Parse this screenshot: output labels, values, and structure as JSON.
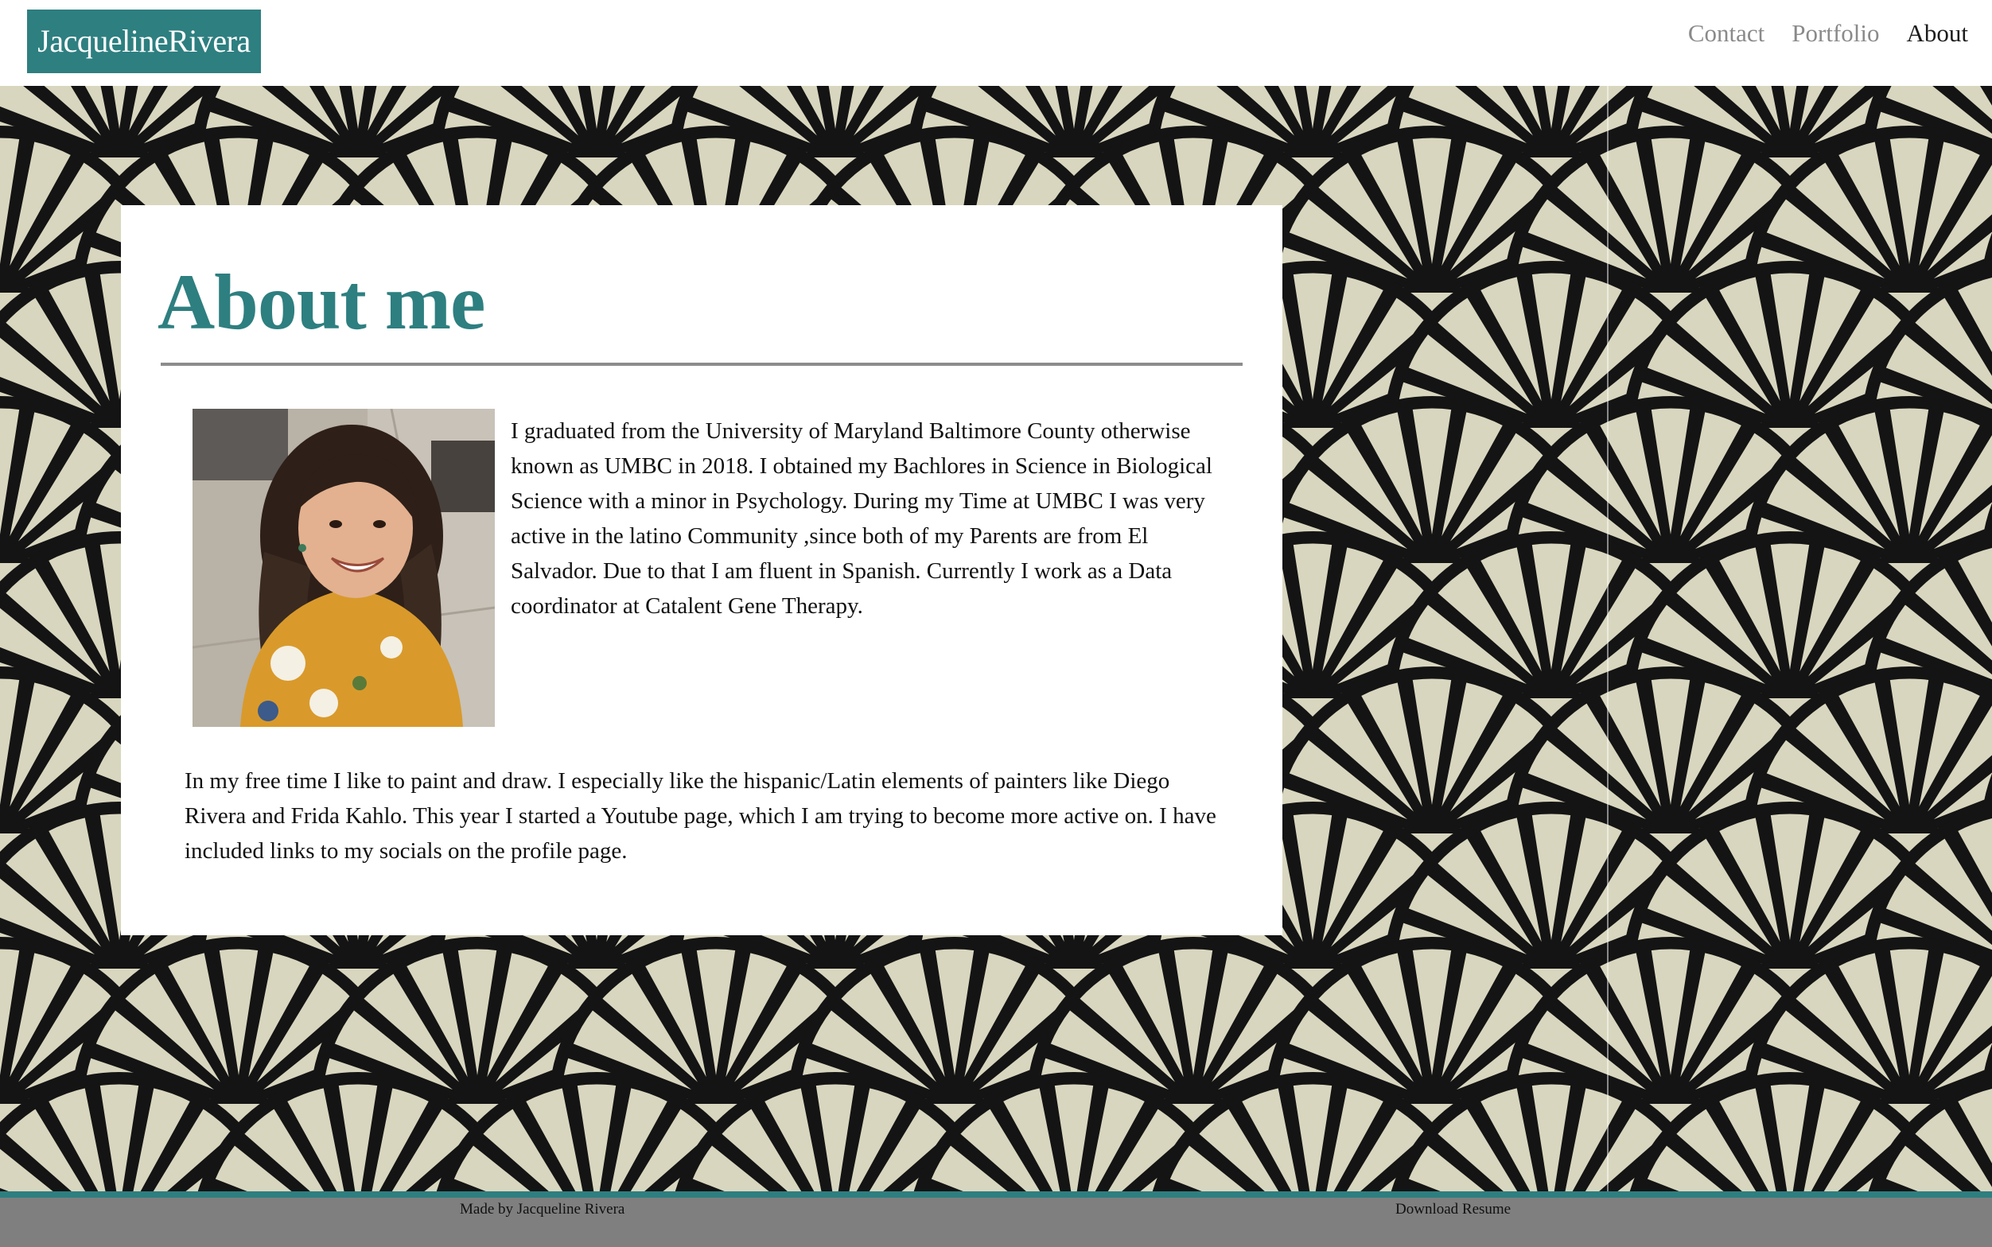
{
  "header": {
    "brand": "JacquelineRivera",
    "nav": [
      {
        "label": "Contact"
      },
      {
        "label": "Portfolio"
      },
      {
        "label": "About"
      }
    ]
  },
  "about": {
    "title": "About me",
    "paragraph_1": "I graduated from the University of Maryland Baltimore County otherwise known as UMBC in 2018. I obtained my Bachlores in Science in Biological Science with a minor in Psychology. During my Time at UMBC I was very active in the latino Community ,since both of my Parents are from El Salvador. Due to that I am fluent in Spanish. Currently I work as a Data coordinator at Catalent Gene Therapy.",
    "paragraph_2": "In my free time I like to paint and draw. I especially like the hispanic/Latin elements of painters like Diego Rivera and Frida Kahlo. This year I started a Youtube page, which I am trying to become more active on. I have included links to my socials on the profile page."
  },
  "footer": {
    "credit": "Made by Jacqueline Rivera",
    "download_label": "Download Resume"
  },
  "colors": {
    "accent": "#2e7f80",
    "footer_bg": "#7f7f7f",
    "pattern_light": "#d9d6bf",
    "pattern_dark": "#141414"
  }
}
